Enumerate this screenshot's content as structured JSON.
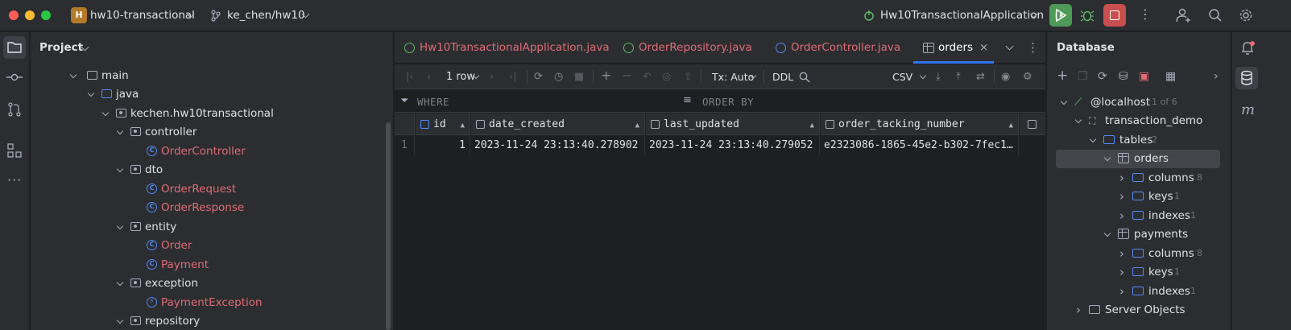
{
  "titlebar": {
    "project_badge": "H",
    "project_name": "hw10-transactional",
    "branch": "ke_chen/hw10",
    "run_config": "Hw10TransactionalApplication"
  },
  "project_panel": {
    "title": "Project",
    "tree": [
      {
        "label": "main",
        "kind": "folder",
        "level": 0
      },
      {
        "label": "java",
        "kind": "folder",
        "level": 1
      },
      {
        "label": "kechen.hw10transactional",
        "kind": "package",
        "level": 2
      },
      {
        "label": "controller",
        "kind": "package",
        "level": 3
      },
      {
        "label": "OrderController",
        "kind": "class",
        "level": 4
      },
      {
        "label": "dto",
        "kind": "package",
        "level": 3
      },
      {
        "label": "OrderRequest",
        "kind": "class",
        "level": 4
      },
      {
        "label": "OrderResponse",
        "kind": "class",
        "level": 4
      },
      {
        "label": "entity",
        "kind": "package",
        "level": 3
      },
      {
        "label": "Order",
        "kind": "class",
        "level": 4
      },
      {
        "label": "Payment",
        "kind": "class",
        "level": 4
      },
      {
        "label": "exception",
        "kind": "package",
        "level": 3
      },
      {
        "label": "PaymentException",
        "kind": "exception",
        "level": 4
      },
      {
        "label": "repository",
        "kind": "package",
        "level": 3
      }
    ]
  },
  "editor": {
    "tabs": [
      {
        "label": "Hw10TransactionalApplication.java",
        "icon": "spring-class-icon"
      },
      {
        "label": "OrderRepository.java",
        "icon": "interface-icon"
      },
      {
        "label": "OrderController.java",
        "icon": "class-icon"
      },
      {
        "label": "orders",
        "icon": "table-icon",
        "active": true
      }
    ],
    "toolbar": {
      "rows": "1 row",
      "tx": "Tx: Auto",
      "ddl": "DDL",
      "format": "CSV"
    },
    "filter": {
      "where": "WHERE",
      "order_by": "ORDER BY"
    },
    "grid": {
      "columns": [
        "id",
        "date_created",
        "last_updated",
        "order_tacking_number"
      ],
      "rows": [
        {
          "num": "1",
          "cells": [
            "1",
            "2023-11-24 23:13:40.278902",
            "2023-11-24 23:13:40.279052",
            "e2323086-1865-45e2-b302-7fec1…"
          ]
        }
      ]
    }
  },
  "database_panel": {
    "title": "Database",
    "host": "@localhost",
    "host_count": "1 of 6",
    "schema": "transaction_demo",
    "tables_label": "tables",
    "tables_count": "2",
    "orders": "orders",
    "payments": "payments",
    "columns": "columns",
    "columns_count": "8",
    "keys": "keys",
    "keys_count": "1",
    "indexes": "indexes",
    "indexes_count": "1",
    "server_objects": "Server Objects"
  },
  "colors": {
    "accent": "#3574f0",
    "modified_file": "#e06c75",
    "run_green": "#4e9a56",
    "stop_red": "#c94f4f"
  }
}
